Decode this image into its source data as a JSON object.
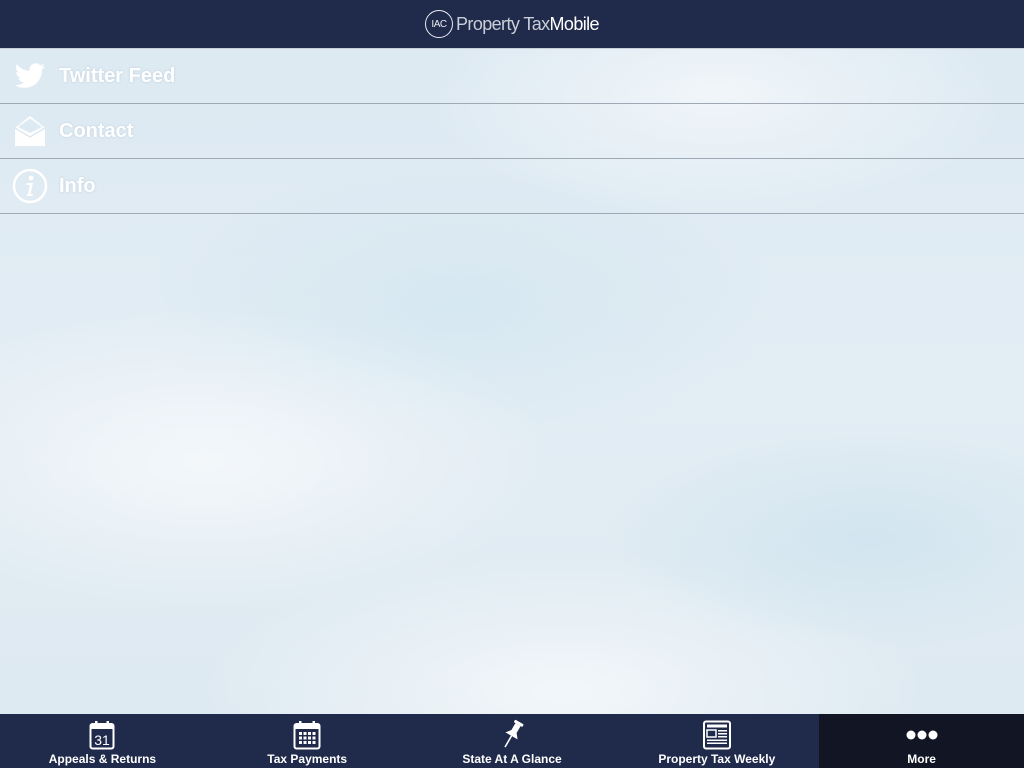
{
  "header": {
    "logo_text": "IAC",
    "title_light": "Property Tax",
    "title_bold": "Mobile"
  },
  "menu": {
    "items": [
      {
        "label": "Twitter Feed",
        "icon": "twitter-icon"
      },
      {
        "label": "Contact",
        "icon": "mail-icon"
      },
      {
        "label": "Info",
        "icon": "info-icon"
      }
    ]
  },
  "tabbar": {
    "tabs": [
      {
        "label": "Appeals & Returns",
        "icon": "calendar-31-icon",
        "calendar_day": "31",
        "active": false
      },
      {
        "label": "Tax Payments",
        "icon": "calendar-grid-icon",
        "active": false
      },
      {
        "label": "State At A Glance",
        "icon": "pushpin-icon",
        "active": false
      },
      {
        "label": "Property Tax Weekly",
        "icon": "newspaper-icon",
        "active": false
      },
      {
        "label": "More",
        "icon": "more-dots-icon",
        "active": true
      }
    ]
  },
  "colors": {
    "bar_background": "#202a4a",
    "active_tab_background": "#121624"
  }
}
